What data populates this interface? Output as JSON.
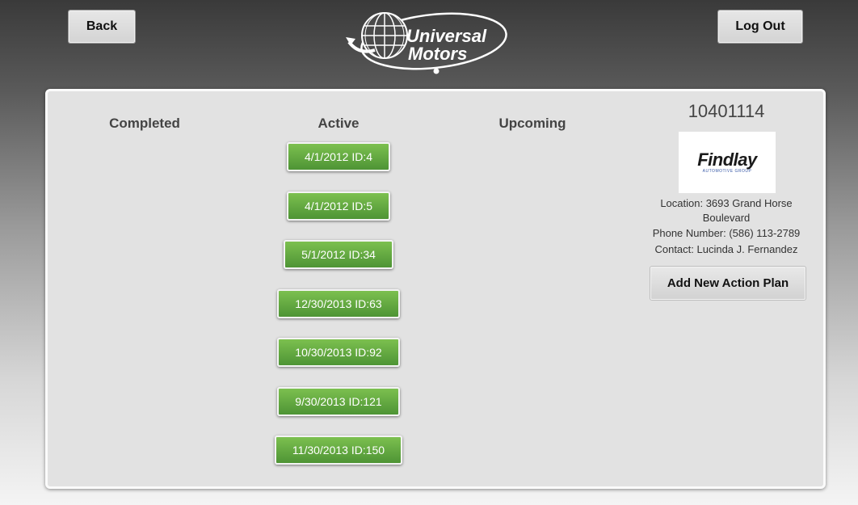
{
  "header": {
    "back_label": "Back",
    "logout_label": "Log Out",
    "logo": {
      "line1": "Universal",
      "line2": "Motors"
    }
  },
  "columns": {
    "completed": "Completed",
    "active": "Active",
    "upcoming": "Upcoming"
  },
  "active_plans": [
    "4/1/2012 ID:4",
    "4/1/2012 ID:5",
    "5/1/2012 ID:34",
    "12/30/2013 ID:63",
    "10/30/2013 ID:92",
    "9/30/2013 ID:121",
    "11/30/2013 ID:150"
  ],
  "customer": {
    "id": "10401114",
    "logo_name": "Findlay",
    "logo_subtitle": "AUTOMOTIVE GROUP",
    "location": "Location: 3693 Grand Horse Boulevard",
    "phone": "Phone Number: (586) 113-2789",
    "contact": "Contact: Lucinda J. Fernandez",
    "add_action_label": "Add New Action Plan"
  },
  "colors": {
    "plan_button_top": "#7cc04f",
    "plan_button_bottom": "#4e9435",
    "panel_background": "#e2e2e2"
  }
}
